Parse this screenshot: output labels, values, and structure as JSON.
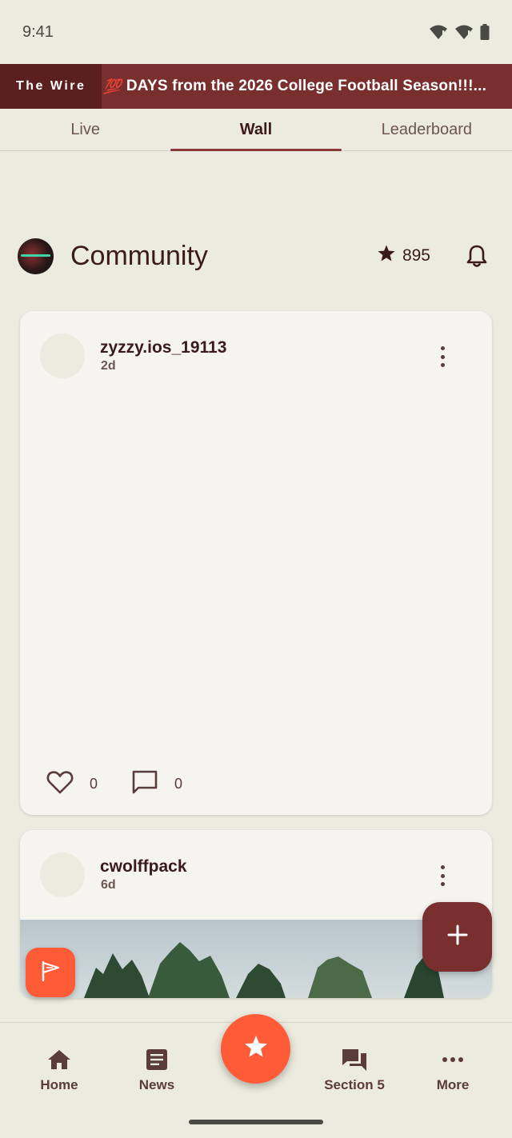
{
  "status_bar": {
    "time": "9:41"
  },
  "ticker": {
    "label": "The Wire",
    "emoji": "💯",
    "text": "DAYS from the 2026 College Football Season!!!..."
  },
  "tabs": [
    {
      "label": "Live",
      "active": false
    },
    {
      "label": "Wall",
      "active": true
    },
    {
      "label": "Leaderboard",
      "active": false
    }
  ],
  "community": {
    "title": "Community",
    "points": "895"
  },
  "posts": [
    {
      "username": "zyzzy.ios_19113",
      "time": "2d",
      "likes": "0",
      "comments": "0"
    },
    {
      "username": "cwolffpack",
      "time": "6d"
    }
  ],
  "bottom_nav": [
    {
      "label": "Home",
      "icon": "home-icon"
    },
    {
      "label": "News",
      "icon": "news-icon"
    },
    {
      "label": "Section 5",
      "icon": "chat-icon"
    },
    {
      "label": "More",
      "icon": "more-icon"
    }
  ],
  "colors": {
    "primary": "#7a2f2f",
    "accent": "#ff5b36",
    "background": "#ecebdf",
    "card": "#f5f4ee"
  }
}
